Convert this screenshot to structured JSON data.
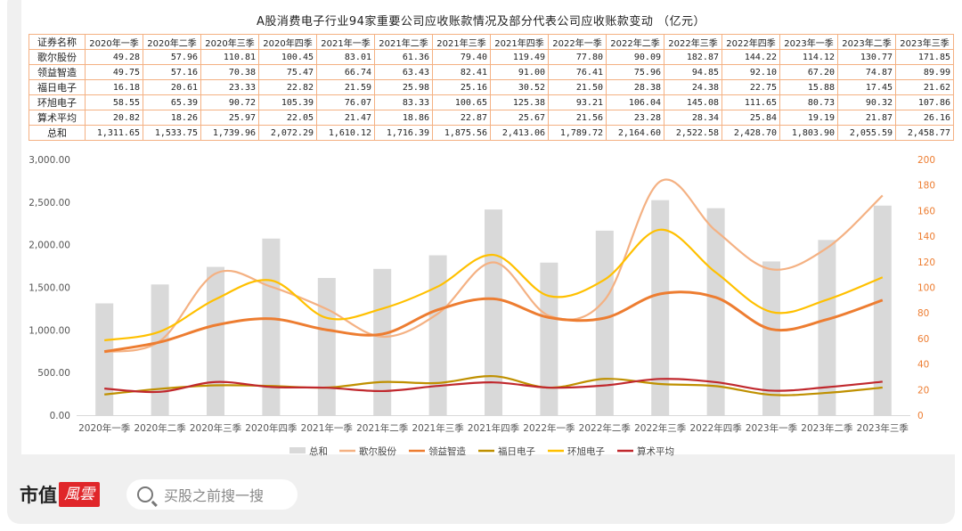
{
  "chart_data": {
    "type": "bar+line",
    "title": "A股消费电子行业94家重要公司应收账款情况及部分代表公司应收账款变动 （亿元）",
    "categories": [
      "2020年一季",
      "2020年二季",
      "2020年三季",
      "2020年四季",
      "2021年一季",
      "2021年二季",
      "2021年三季",
      "2021年四季",
      "2022年一季",
      "2022年二季",
      "2022年三季",
      "2022年四季",
      "2023年一季",
      "2023年二季",
      "2023年三季"
    ],
    "table_header_first": "证券名称",
    "series": [
      {
        "name": "歌尔股份",
        "type": "line",
        "axis": "right",
        "color": "#f4b183",
        "values": [
          49.28,
          57.96,
          110.81,
          100.45,
          83.01,
          61.36,
          79.4,
          119.49,
          77.8,
          90.09,
          182.87,
          144.22,
          114.12,
          130.77,
          171.85
        ],
        "labels": [
          "49.28",
          "57.96",
          "110.81",
          "100.45",
          "83.01",
          "61.36",
          "79.40",
          "119.49",
          "77.80",
          "90.09",
          "182.87",
          "144.22",
          "114.12",
          "130.77",
          "171.85"
        ]
      },
      {
        "name": "领益智造",
        "type": "line",
        "axis": "right",
        "color": "#ed7d31",
        "values": [
          49.75,
          57.16,
          70.38,
          75.47,
          66.74,
          63.43,
          82.41,
          91.0,
          76.41,
          75.96,
          94.85,
          92.1,
          67.2,
          74.87,
          89.99
        ],
        "labels": [
          "49.75",
          "57.16",
          "70.38",
          "75.47",
          "66.74",
          "63.43",
          "82.41",
          "91.00",
          "76.41",
          "75.96",
          "94.85",
          "92.10",
          "67.20",
          "74.87",
          "89.99"
        ]
      },
      {
        "name": "福日电子",
        "type": "line",
        "axis": "right",
        "color": "#bf9000",
        "values": [
          16.18,
          20.61,
          23.33,
          22.82,
          21.59,
          25.98,
          25.16,
          30.52,
          21.5,
          28.38,
          24.38,
          22.75,
          15.88,
          17.45,
          21.62
        ],
        "labels": [
          "16.18",
          "20.61",
          "23.33",
          "22.82",
          "21.59",
          "25.98",
          "25.16",
          "30.52",
          "21.50",
          "28.38",
          "24.38",
          "22.75",
          "15.88",
          "17.45",
          "21.62"
        ]
      },
      {
        "name": "环旭电子",
        "type": "line",
        "axis": "right",
        "color": "#ffc000",
        "values": [
          58.55,
          65.39,
          90.72,
          105.39,
          76.07,
          83.33,
          100.65,
          125.38,
          93.21,
          106.04,
          145.08,
          111.65,
          80.73,
          90.32,
          107.86
        ],
        "labels": [
          "58.55",
          "65.39",
          "90.72",
          "105.39",
          "76.07",
          "83.33",
          "100.65",
          "125.38",
          "93.21",
          "106.04",
          "145.08",
          "111.65",
          "80.73",
          "90.32",
          "107.86"
        ]
      },
      {
        "name": "算术平均",
        "type": "line",
        "axis": "right",
        "color": "#c0282d",
        "values": [
          20.82,
          18.26,
          25.97,
          22.05,
          21.47,
          18.86,
          22.87,
          25.67,
          21.56,
          23.28,
          28.34,
          25.84,
          19.19,
          21.87,
          26.16
        ],
        "labels": [
          "20.82",
          "18.26",
          "25.97",
          "22.05",
          "21.47",
          "18.86",
          "22.87",
          "25.67",
          "21.56",
          "23.28",
          "28.34",
          "25.84",
          "19.19",
          "21.87",
          "26.16"
        ]
      },
      {
        "name": "总和",
        "type": "bar",
        "axis": "left",
        "color": "#d9d9d9",
        "values": [
          1311.65,
          1533.75,
          1739.96,
          2072.29,
          1610.12,
          1716.39,
          1875.56,
          2413.06,
          1789.72,
          2164.6,
          2522.58,
          2428.7,
          1803.9,
          2055.59,
          2458.77
        ],
        "labels": [
          "1,311.65",
          "1,533.75",
          "1,739.96",
          "2,072.29",
          "1,610.12",
          "1,716.39",
          "1,875.56",
          "2,413.06",
          "1,789.72",
          "2,164.60",
          "2,522.58",
          "2,428.70",
          "1,803.90",
          "2,055.59",
          "2,458.77"
        ]
      }
    ],
    "legend_order": [
      "总和",
      "歌尔股份",
      "领益智造",
      "福日电子",
      "环旭电子",
      "算术平均"
    ],
    "legend_position": "bottom",
    "left_axis": {
      "range": [
        0,
        3000
      ],
      "ticks": [
        "0.00",
        "500.00",
        "1,000.00",
        "1,500.00",
        "2,000.00",
        "2,500.00",
        "3,000.00"
      ]
    },
    "right_axis": {
      "range": [
        0,
        200
      ],
      "ticks": [
        "0",
        "20",
        "40",
        "60",
        "80",
        "100",
        "120",
        "140",
        "160",
        "180",
        "200"
      ],
      "color": "#ed7d31"
    },
    "grid": false
  },
  "footer": {
    "brand": "市值",
    "brand_red": "風雲",
    "search_placeholder": "买股之前搜一搜"
  }
}
